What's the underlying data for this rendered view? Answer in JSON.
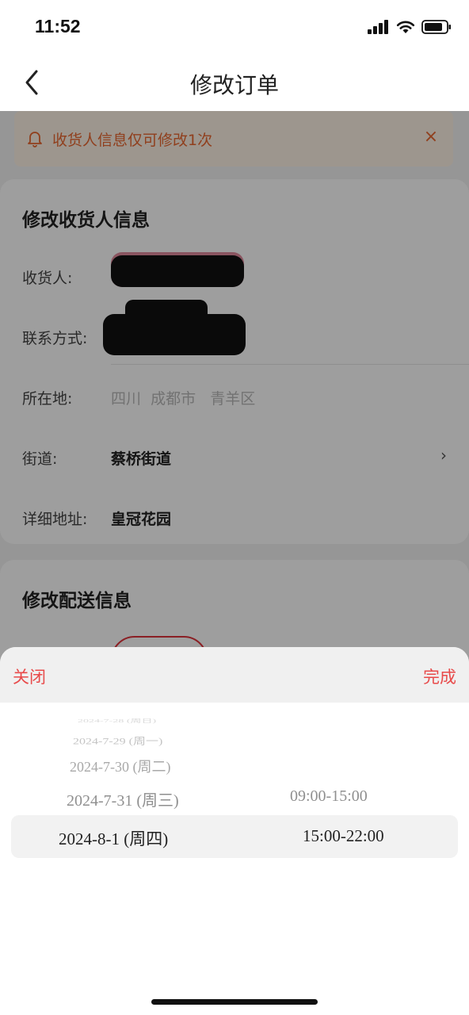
{
  "status_bar": {
    "time": "11:52",
    "icons": [
      "signal-icon",
      "wifi-icon",
      "battery-icon"
    ]
  },
  "nav": {
    "title": "修改订单",
    "back_icon": "chevron-left-icon"
  },
  "notice": {
    "text": "收货人信息仅可修改1次",
    "close": "×"
  },
  "receiver_card": {
    "title": "修改收货人信息",
    "fields": {
      "receiver_label": "收货人:",
      "contact_label": "联系方式:",
      "location_label": "所在地:",
      "location_value": "四川  成都市   青羊区",
      "street_label": "街道:",
      "street_value": "蔡桥街道",
      "street_arrow": "›",
      "address_label": "详细地址:",
      "address_value": "皇冠花园"
    }
  },
  "delivery_card": {
    "title": "修改配送信息"
  },
  "sheet": {
    "close_label": "关闭",
    "done_label": "完成",
    "dates": [
      "2024-7-28 (周日)",
      "2024-7-29 (周一)",
      "2024-7-30 (周二)",
      "2024-7-31 (周三)",
      "2024-8-1 (周四)"
    ],
    "times": [
      "09:00-15:00",
      "15:00-22:00"
    ],
    "selected_date": "2024-8-1 (周四)",
    "selected_time": "15:00-22:00"
  },
  "colors": {
    "accent": "#e84a4a",
    "notice_text": "#e8662f",
    "notice_bg": "#fdf3e6"
  }
}
